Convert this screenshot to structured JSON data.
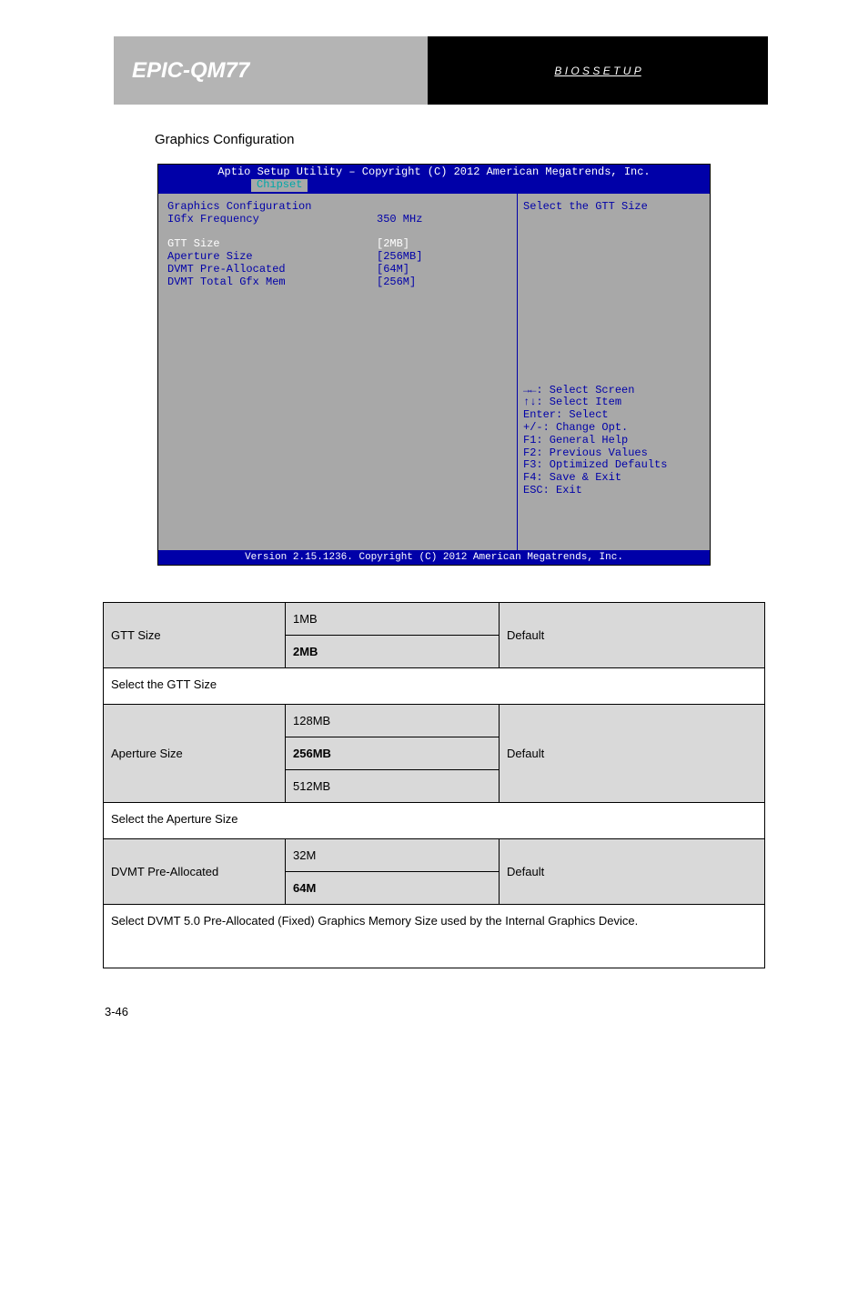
{
  "header": {
    "left_title": "EPIC-QM77",
    "right_link": "B I O S S E T U P"
  },
  "subtitle": "Graphics Configuration",
  "bios": {
    "topbar": "Aptio Setup Utility – Copyright (C) 2012 American Megatrends, Inc.",
    "tab": "Chipset",
    "left": {
      "heading": "Graphics Configuration",
      "rows": [
        {
          "label": "IGfx Frequency",
          "value": "350 MHz"
        },
        {
          "label": "GTT Size",
          "value": "[2MB]"
        },
        {
          "label": "Aperture Size",
          "value": "[256MB]"
        },
        {
          "label": "DVMT Pre-Allocated",
          "value": "[64M]"
        },
        {
          "label": "DVMT Total Gfx Mem",
          "value": "[256M]"
        }
      ]
    },
    "right": {
      "help_title": "Select the GTT Size",
      "nav": [
        "→←: Select Screen",
        "↑↓: Select Item",
        "Enter: Select",
        "+/-: Change Opt.",
        "F1: General Help",
        "F2: Previous Values",
        "F3: Optimized Defaults",
        "F4: Save & Exit",
        "ESC: Exit"
      ]
    },
    "footer": "Version 2.15.1236. Copyright (C) 2012 American Megatrends, Inc."
  },
  "options_table": {
    "rows": [
      {
        "type": "option",
        "name": "GTT Size",
        "values": [
          "1MB",
          "2MB"
        ],
        "default": "Default",
        "shaded": true
      },
      {
        "type": "desc",
        "text": "Select the GTT Size"
      },
      {
        "type": "option",
        "name": "Aperture Size",
        "values": [
          "128MB",
          "256MB",
          "512MB"
        ],
        "default": "Default",
        "shaded": true
      },
      {
        "type": "desc",
        "text": "Select the Aperture Size"
      },
      {
        "type": "option",
        "name": "DVMT Pre-Allocated",
        "values": [
          "32M",
          "64M"
        ],
        "default": "Default",
        "shaded": true
      },
      {
        "type": "desc",
        "text": "Select DVMT 5.0 Pre-Allocated (Fixed) Graphics Memory Size used by the Internal Graphics Device.",
        "multiline": true
      }
    ]
  },
  "page_number": "3-46"
}
